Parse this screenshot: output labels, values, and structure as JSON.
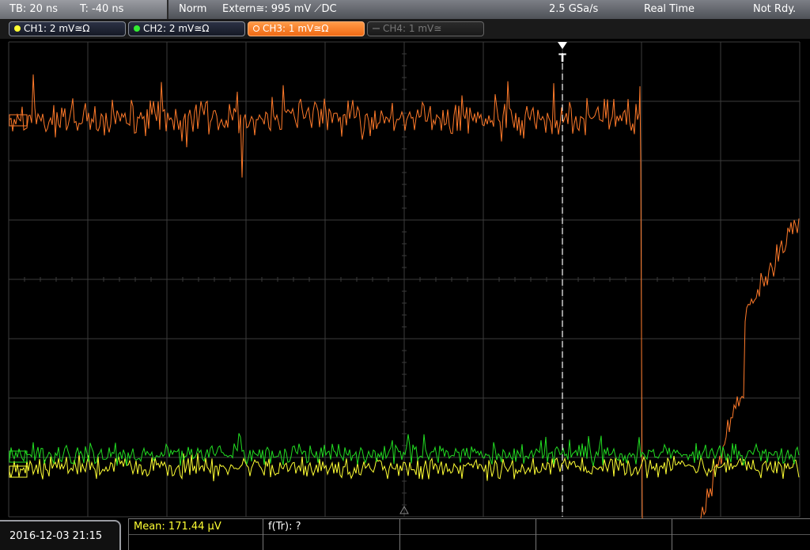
{
  "topbar": {
    "timebase": "TB: 20 ns",
    "trigger_time": "T: -40 ns",
    "mode": "Norm",
    "trigger_source": "Extern≅: 995 mV ⟋DC",
    "sample_rate": "2.5 GSa/s",
    "acquisition": "Real Time",
    "status": "Not Rdy."
  },
  "channels": [
    {
      "label": "CH1: 2 mV≅Ω",
      "color": "#ffff33",
      "state": "on"
    },
    {
      "label": "CH2: 2 mV≅Ω",
      "color": "#33ee33",
      "state": "on"
    },
    {
      "label": "CH3: 1 mV≅Ω",
      "color": "#ff7a2a",
      "state": "active"
    },
    {
      "label": "CH4: 1 mV≅",
      "color": "#777777",
      "state": "off"
    }
  ],
  "trigger_marker": "T",
  "bottom": {
    "datetime": "2016-12-03 21:15",
    "measurement1": "Mean: 171.44 µV",
    "measurement2": "f(Tr): ?"
  },
  "colors": {
    "grid": "#3c3c3c",
    "ch1": "#ffff33",
    "ch2": "#22dd22",
    "ch3": "#ff7a2a"
  }
}
